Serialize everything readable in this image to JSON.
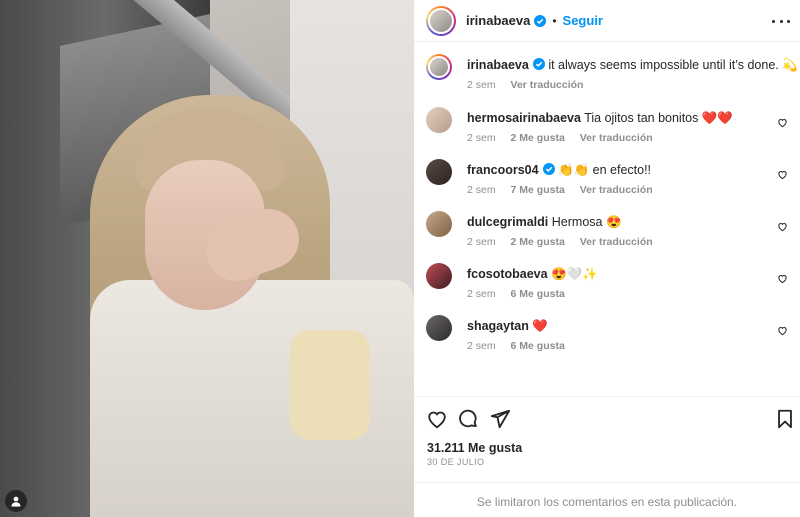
{
  "post": {
    "author": "irinabaeva",
    "follow_label": "Seguir",
    "separator": "•",
    "caption": "it always seems impossible until it’s done. 💫",
    "caption_time": "2 sem",
    "caption_translate": "Ver traducción",
    "likes_text": "31.211 Me gusta",
    "date_text": "30 DE JULIO",
    "comments_limited": "Se limitaron los comentarios en esta publicación."
  },
  "comments": [
    {
      "user": "hermosairinabaeva",
      "text": "Tia ojitos tan bonitos ❤️❤️",
      "time": "2 sem",
      "likes": "2 Me gusta",
      "translate": "Ver traducción"
    },
    {
      "user": "francoors04",
      "verified": true,
      "text": "👏👏 en efecto!!",
      "time": "2 sem",
      "likes": "7 Me gusta",
      "translate": "Ver traducción"
    },
    {
      "user": "dulcegrimaldi",
      "text": "Hermosa 😍",
      "time": "2 sem",
      "likes": "2 Me gusta",
      "translate": "Ver traducción"
    },
    {
      "user": "fcosotobaeva",
      "text": "😍🤍✨",
      "time": "2 sem",
      "likes": "6 Me gusta"
    },
    {
      "user": "shagaytan",
      "text": "❤️",
      "time": "2 sem",
      "likes": "6 Me gusta"
    }
  ],
  "icons": {
    "header_more": "more-icon",
    "verified": "verified-badge-icon",
    "comment_like": "heart-outline-icon",
    "actions": [
      "heart-icon",
      "comment-icon",
      "share-icon",
      "bookmark-icon"
    ],
    "photo_tag": "user-tag-icon"
  },
  "colors": {
    "accent": "#0095f6",
    "muted": "#8e8e8e",
    "text": "#262626",
    "verified": "#0095f6"
  }
}
